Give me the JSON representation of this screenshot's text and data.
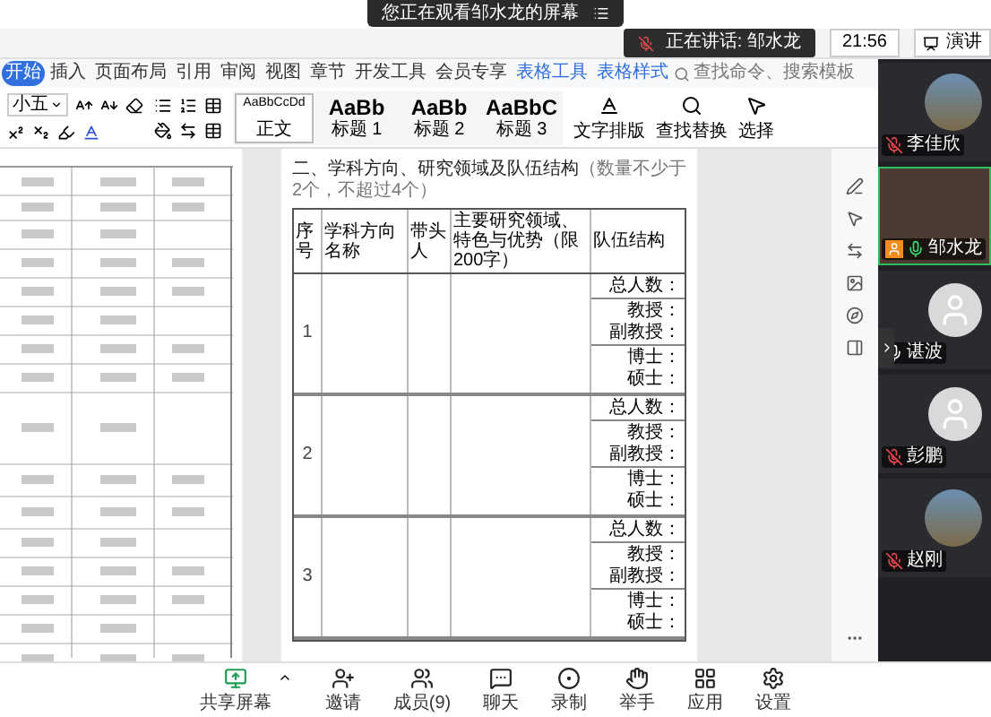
{
  "banner": {
    "text": "您正在观看邹水龙的屏幕"
  },
  "top_bar": {
    "speaking": "正在讲话: 邹水龙",
    "time": "21:56",
    "present_button": "演讲"
  },
  "ribbon_tabs": [
    {
      "label": "开始",
      "kind": "tab",
      "selected": true
    },
    {
      "label": "插入",
      "kind": "tab",
      "selected": false
    },
    {
      "label": "页面布局",
      "kind": "tab",
      "selected": false
    },
    {
      "label": "引用",
      "kind": "tab",
      "selected": false
    },
    {
      "label": "审阅",
      "kind": "tab",
      "selected": false
    },
    {
      "label": "视图",
      "kind": "tab",
      "selected": false
    },
    {
      "label": "章节",
      "kind": "tab",
      "selected": false
    },
    {
      "label": "开发工具",
      "kind": "tab",
      "selected": false
    },
    {
      "label": "会员专享",
      "kind": "tab",
      "selected": false
    },
    {
      "label": "表格工具",
      "kind": "contextual",
      "selected": false
    },
    {
      "label": "表格样式",
      "kind": "contextual",
      "selected": false
    },
    {
      "label": "查找命令、搜索模板",
      "kind": "search",
      "selected": false
    }
  ],
  "ribbon": {
    "font_size": "小五",
    "styles": [
      {
        "preview": "AaBbCcDd",
        "label": "正文",
        "selected": true
      },
      {
        "preview": "AaBb",
        "label": "标题 1",
        "selected": false
      },
      {
        "preview": "AaBb",
        "label": "标题 2",
        "selected": false
      },
      {
        "preview": "AaBbC",
        "label": "标题 3",
        "selected": false
      }
    ],
    "tools": [
      "文字排版",
      "查找替换",
      "选择"
    ]
  },
  "document": {
    "heading": "二、学科方向、研究领域及队伍结构",
    "heading_note": "（数量不少于2个，不超过4个）",
    "columns": [
      "序号",
      "学科方向名称",
      "带头人",
      "主要研究领域、特色与优势（限200字）",
      "队伍结构"
    ],
    "rows": [
      {
        "number": "1",
        "structure": [
          "总人数：",
          "教授：",
          "副教授：",
          "博士：",
          "硕士："
        ]
      },
      {
        "number": "2",
        "structure": [
          "总人数：",
          "教授：",
          "副教授：",
          "博士：",
          "硕士："
        ]
      },
      {
        "number": "3",
        "structure": [
          "总人数：",
          "教授：",
          "副教授：",
          "博士：",
          "硕士："
        ]
      }
    ]
  },
  "participants": [
    {
      "name": "李佳欣",
      "muted": true,
      "speaking": false,
      "video_on": false,
      "has_photo": true,
      "highlighted": false,
      "host": false
    },
    {
      "name": "邹水龙",
      "muted": false,
      "speaking": true,
      "video_on": true,
      "highlighted": true,
      "host": true
    },
    {
      "name": "谌波",
      "muted": false,
      "speaking": false,
      "video_on": false,
      "has_photo": false,
      "highlighted": false,
      "host": false
    },
    {
      "name": "彭鹏",
      "muted": true,
      "speaking": false,
      "video_on": false,
      "has_photo": false,
      "highlighted": false,
      "host": false
    },
    {
      "name": "赵刚",
      "muted": true,
      "speaking": false,
      "video_on": false,
      "has_photo": true,
      "highlighted": false,
      "host": false
    }
  ],
  "toolbar": [
    {
      "label": "共享屏幕",
      "kind": "share",
      "active": true
    },
    {
      "label": "邀请",
      "kind": "invite",
      "active": false
    },
    {
      "label": "成员(9)",
      "kind": "members",
      "active": false
    },
    {
      "label": "聊天",
      "kind": "chat",
      "active": false
    },
    {
      "label": "录制",
      "kind": "record",
      "active": false
    },
    {
      "label": "举手",
      "kind": "hand",
      "active": false
    },
    {
      "label": "应用",
      "kind": "apps",
      "active": false
    },
    {
      "label": "设置",
      "kind": "settings",
      "active": false
    }
  ]
}
